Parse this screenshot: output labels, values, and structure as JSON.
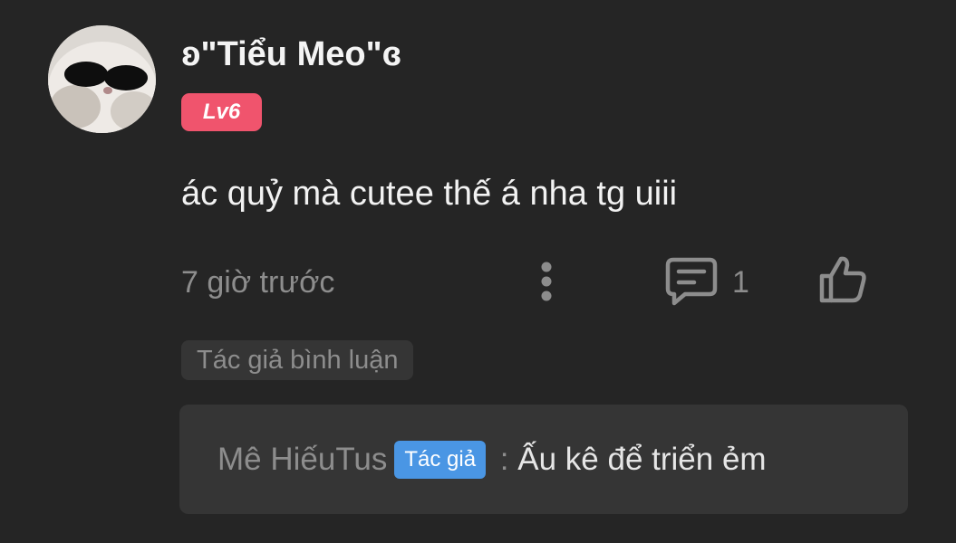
{
  "comment": {
    "username": "ʚ\"Tiểu Meo\"ɞ",
    "level": "Lv6",
    "text": "ác quỷ mà cutee thế á nha tg uiii",
    "timestamp": "7 giờ trước",
    "reply_count": "1",
    "author_reply_tag": "Tác giả bình luận"
  },
  "reply": {
    "author": "Mê HiếuTus",
    "author_badge": "Tác giả",
    "separator": " : ",
    "text": "Ấu kê để triển ẻm"
  },
  "icons": {
    "more": "vertical-dots-icon",
    "reply": "comment-bubble-icon",
    "like": "thumbs-up-icon"
  },
  "colors": {
    "background": "#252525",
    "level_badge": "#f0546d",
    "author_badge": "#4a96e4",
    "muted_text": "#8d8d8d",
    "panel": "#353535"
  }
}
